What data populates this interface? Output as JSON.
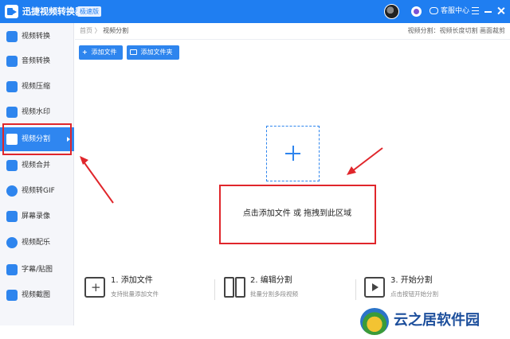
{
  "app": {
    "title": "迅捷视频转换器",
    "edition_badge": "极速版",
    "support_label": "客服中心"
  },
  "sidebar": {
    "items": [
      {
        "label": "视频转换",
        "icon": "video-convert-icon"
      },
      {
        "label": "音频转换",
        "icon": "audio-convert-icon"
      },
      {
        "label": "视频压缩",
        "icon": "video-compress-icon"
      },
      {
        "label": "视频水印",
        "icon": "video-watermark-icon"
      },
      {
        "label": "视频分割",
        "icon": "video-split-icon",
        "active": true
      },
      {
        "label": "视频合并",
        "icon": "video-merge-icon"
      },
      {
        "label": "视频转GIF",
        "icon": "video-gif-icon"
      },
      {
        "label": "屏幕录像",
        "icon": "screen-record-icon"
      },
      {
        "label": "视频配乐",
        "icon": "video-music-icon"
      },
      {
        "label": "字幕/贴图",
        "icon": "subtitle-sticker-icon"
      },
      {
        "label": "视频截图",
        "icon": "video-screenshot-icon"
      }
    ]
  },
  "main": {
    "breadcrumb": {
      "home": "首页",
      "separator": "〉",
      "current": "视频分割"
    },
    "top_hint": "视频分割：视频长度切割 画面裁剪",
    "buttons": {
      "add_file": "添加文件",
      "add_folder": "添加文件夹"
    },
    "drop_text": "点击添加文件 或 拖拽到此区域",
    "steps": [
      {
        "title": "1. 添加文件",
        "desc": "支持批量添加文件"
      },
      {
        "title": "2. 编辑分割",
        "desc": "批量分割多段视频"
      },
      {
        "title": "3. 开始分割",
        "desc": "点击按钮开始分割"
      }
    ]
  },
  "watermark": {
    "text": "云之居软件园"
  },
  "colors": {
    "accent": "#2e85ee",
    "titlebar": "#1f7ef1",
    "annotation": "#e0262b"
  }
}
